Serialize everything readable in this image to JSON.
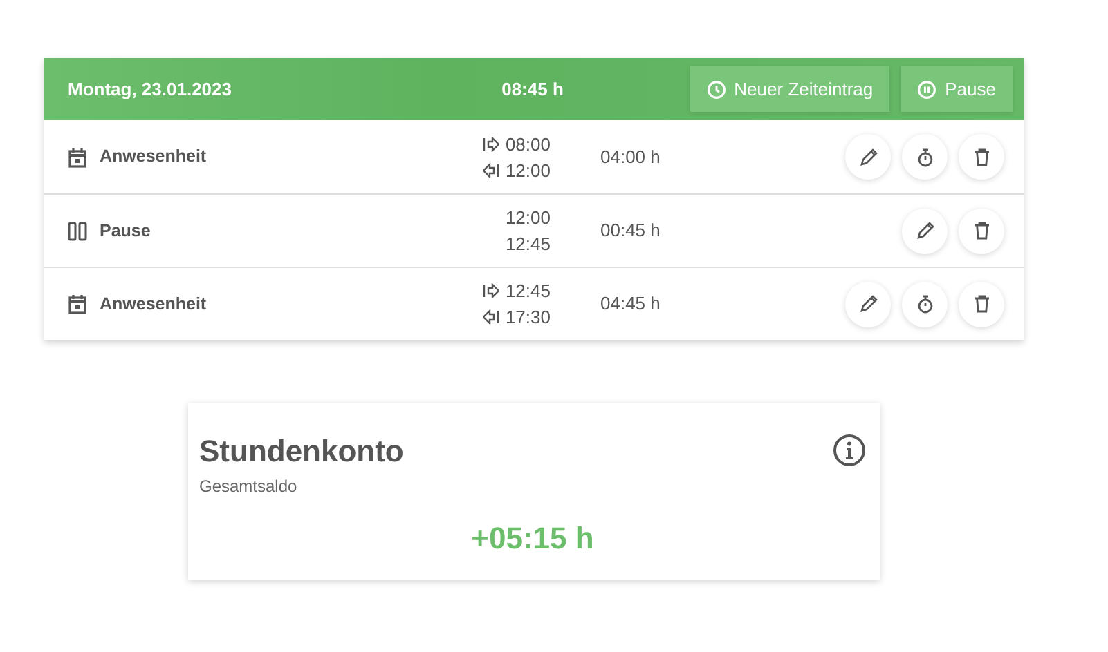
{
  "day_card": {
    "date": "Montag, 23.01.2023",
    "total": "08:45 h",
    "buttons": [
      {
        "kind": "new",
        "label": "Neuer Zeiteintrag"
      },
      {
        "kind": "pause",
        "label": "Pause"
      }
    ],
    "entries": [
      {
        "kind": "presence",
        "label": "Anwesenheit",
        "start": "08:00",
        "end": "12:00",
        "duration": "04:00 h",
        "actions": [
          {
            "kind": "edit"
          },
          {
            "kind": "timer"
          },
          {
            "kind": "delete"
          }
        ]
      },
      {
        "kind": "break",
        "label": "Pause",
        "start": "12:00",
        "end": "12:45",
        "duration": "00:45 h",
        "actions": [
          {
            "kind": "edit"
          },
          {
            "kind": "delete"
          }
        ]
      },
      {
        "kind": "presence",
        "label": "Anwesenheit",
        "start": "12:45",
        "end": "17:30",
        "duration": "04:45 h",
        "actions": [
          {
            "kind": "edit"
          },
          {
            "kind": "timer"
          },
          {
            "kind": "delete"
          }
        ]
      }
    ]
  },
  "balance_card": {
    "title": "Stundenkonto",
    "subtitle": "Gesamtsaldo",
    "value": "+05:15 h"
  }
}
